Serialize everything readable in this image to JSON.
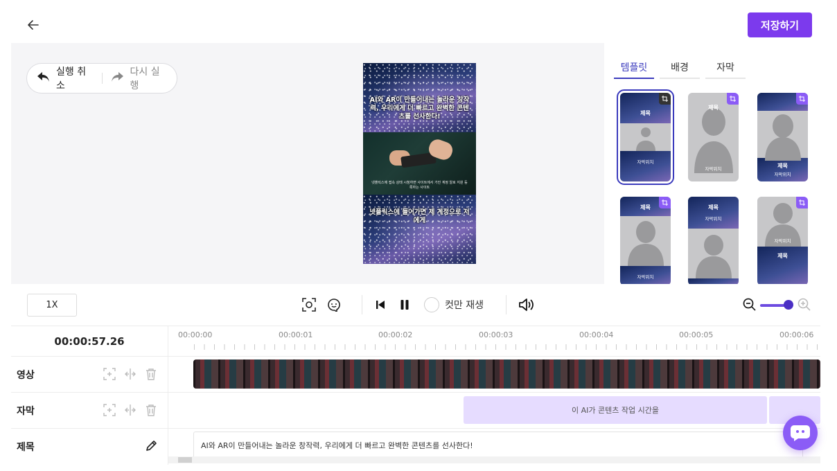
{
  "header": {
    "save_label": "저장하기"
  },
  "history": {
    "undo_label": "실행 취소",
    "redo_label": "다시 실행"
  },
  "preview": {
    "title_text": "AI와 AR이 만들어내는 놀라운 창작력, 우리에게 더 빠르고 완벽한 콘텐츠를 선사한다!",
    "caption_small": "넷플릭스에 접속 상태 시청하면 사이트에서 가진 계정 알로 지원 등록하는 사이트",
    "subtitle_text": "넷플릭스에 들어가면 제 계정으로 저에게"
  },
  "panel": {
    "tabs": [
      "템플릿",
      "배경",
      "자막"
    ],
    "active_tab": 0,
    "template_title": "제목",
    "template_subtitle": "자막위치"
  },
  "controls": {
    "speed": "1X",
    "cut_only_label": "컷만 재생"
  },
  "timeline": {
    "current_time": "00:00:57.26",
    "ruler": [
      "00:00:00",
      "00:00:01",
      "00:00:02",
      "00:00:03",
      "00:00:04",
      "00:00:05",
      "00:00:06"
    ],
    "tracks": {
      "video": "영상",
      "subtitle": "자막",
      "title": "제목"
    },
    "subtitle_clip": "이 AI가 콘텐츠 작업 시간을",
    "title_clip": "AI와 AR이 만들어내는 놀라운 창작력, 우리에게 더 빠르고 완벽한 콘텐츠를 선사한다!"
  },
  "colors": {
    "accent": "#7c3aed",
    "tab_active": "#3b3bbd",
    "subtitle_clip": "#e6dcff"
  }
}
